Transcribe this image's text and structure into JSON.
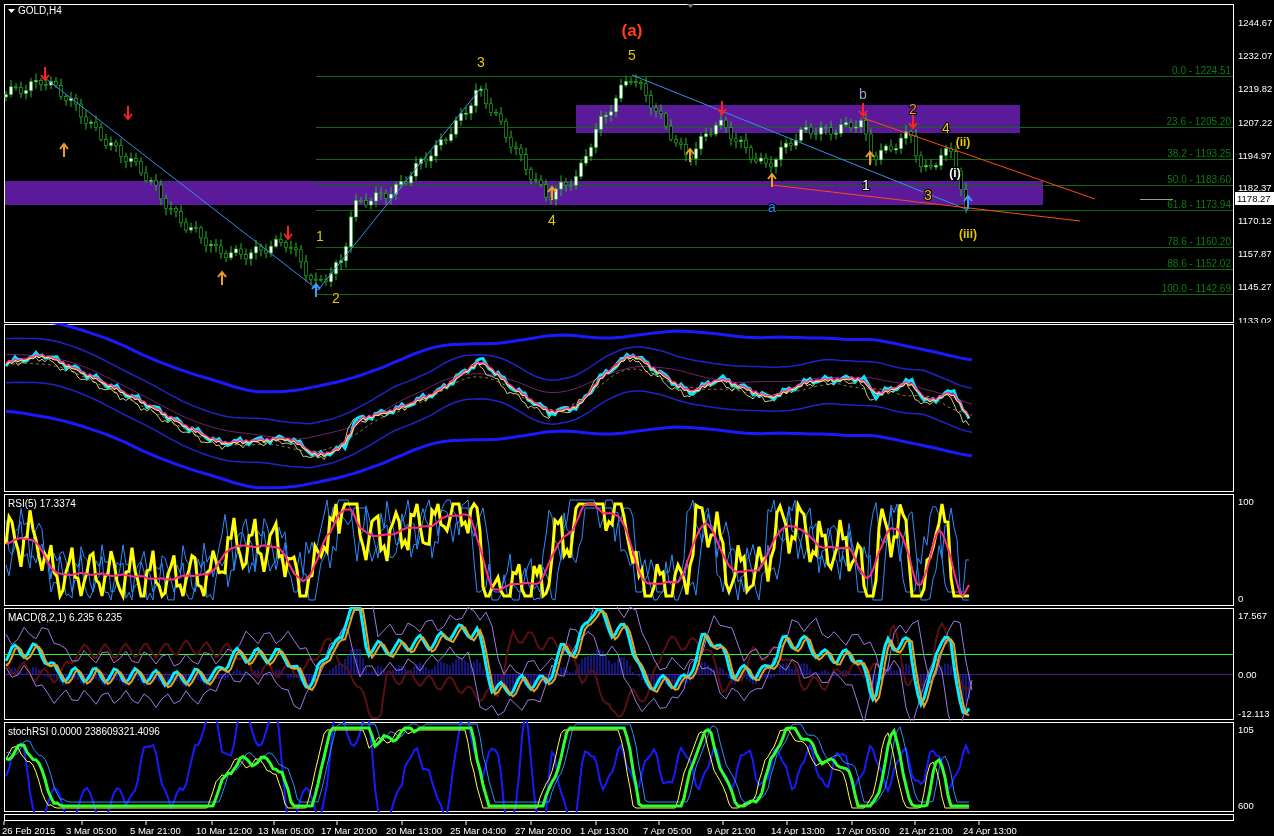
{
  "chart": {
    "title": "GOLD,H4",
    "wave_labels": [
      {
        "text": "(a)",
        "color": "#ff4010"
      },
      {
        "text": "5",
        "color": "#e6c800"
      },
      {
        "text": "3",
        "color": "#e6c800"
      },
      {
        "text": "1",
        "color": "#e6c800"
      },
      {
        "text": "2",
        "color": "#e6c800"
      },
      {
        "text": "4",
        "color": "#e6c800"
      },
      {
        "text": "b",
        "color": "#8fa8c8"
      },
      {
        "text": "2",
        "color": "#ff9a2a"
      },
      {
        "text": "4",
        "color": "#e6c800"
      },
      {
        "text": "(ii)",
        "color": "#e6c800"
      },
      {
        "text": "(i)",
        "color": "#ffffff"
      },
      {
        "text": "1",
        "color": "#ffffff"
      },
      {
        "text": "3",
        "color": "#e6c800"
      },
      {
        "text": "a",
        "color": "#1e90ff"
      },
      {
        "text": "(iii)",
        "color": "#e6c800"
      }
    ],
    "fib_levels": [
      "0.0 - 1224.51",
      "23.6  - 1205.20",
      "38.2 - 1193.25",
      "50.0 - 1183.60",
      "61.8 - 1173.94",
      "78.6 - 1160.20",
      "88.6 - 1152.02",
      "100.0 - 1142.69"
    ],
    "price_axis": [
      "1244.67",
      "1232.07",
      "1219.82",
      "1207.22",
      "1194.97",
      "1182.37",
      "1170.12",
      "1157.87",
      "1145.27",
      "1133.02"
    ],
    "current_price": "1178.27"
  },
  "indicators": [
    {
      "kind": "rsi",
      "label": "RSI(5) 17.3374",
      "axis": [
        "100",
        "0"
      ]
    },
    {
      "kind": "macd",
      "label": "MACD(8,2,1) 6.235 6.235",
      "axis": [
        "17.567",
        "0.00",
        "-12.113"
      ]
    },
    {
      "kind": "stoch",
      "label": "stochRSI 0.0000 238609321.4096",
      "axis": [
        "105",
        "600"
      ]
    }
  ],
  "time_axis": [
    "26 Feb 2015",
    "3 Mar 05:00",
    "5 Mar 21:00",
    "10 Mar 12:00",
    "13 Mar 05:00",
    "17 Mar 20:00",
    "20 Mar 13:00",
    "25 Mar 04:00",
    "27 Mar 20:00",
    "1 Apr 13:00",
    "7 Apr 05:00",
    "9 Apr 21:00",
    "14 Apr 13:00",
    "17 Apr 05:00",
    "21 Apr 21:00",
    "24 Apr 13:00"
  ]
}
